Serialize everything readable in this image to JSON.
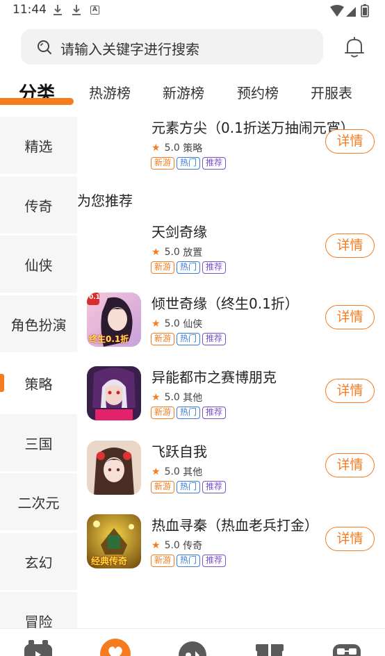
{
  "status_bar": {
    "time": "11:44"
  },
  "search": {
    "placeholder": "请输入关键字进行搜索"
  },
  "tabs": [
    {
      "label": "分类",
      "active": true
    },
    {
      "label": "热游榜",
      "active": false
    },
    {
      "label": "新游榜",
      "active": false
    },
    {
      "label": "预约榜",
      "active": false
    },
    {
      "label": "开服表",
      "active": false
    }
  ],
  "sidebar": {
    "items": [
      {
        "label": "精选"
      },
      {
        "label": "传奇"
      },
      {
        "label": "仙侠"
      },
      {
        "label": "角色扮演"
      },
      {
        "label": "策略"
      },
      {
        "label": "三国"
      },
      {
        "label": "二次元"
      },
      {
        "label": "玄幻"
      },
      {
        "label": "冒险"
      }
    ],
    "active_index": 4
  },
  "section": {
    "title": "为您推荐"
  },
  "games": [
    {
      "name": "元素方尖（0.1折送万抽闹元宵）",
      "rating": "5.0",
      "category": "策略",
      "has_icon": false
    },
    {
      "name": "天剑奇缘",
      "rating": "5.0",
      "category": "放置",
      "has_icon": false
    },
    {
      "name": "倾世奇缘（终生0.1折）",
      "rating": "5.0",
      "category": "仙侠",
      "has_icon": true,
      "icon_text": "终生0.1折",
      "icon_badge": "0.1"
    },
    {
      "name": "异能都市之赛博朋克",
      "rating": "5.0",
      "category": "其他",
      "has_icon": true
    },
    {
      "name": "飞跃自我",
      "rating": "5.0",
      "category": "其他",
      "has_icon": true
    },
    {
      "name": "热血寻秦（热血老兵打金）",
      "rating": "5.0",
      "category": "传奇",
      "has_icon": true,
      "icon_text": "经典传奇"
    }
  ],
  "tags": {
    "new": "新游",
    "hot": "热门",
    "rec": "推荐"
  },
  "detail_label": "详情",
  "colors": {
    "accent": "#f57b1f",
    "hot": "#3a7bd5",
    "rec": "#7a4fd1"
  }
}
